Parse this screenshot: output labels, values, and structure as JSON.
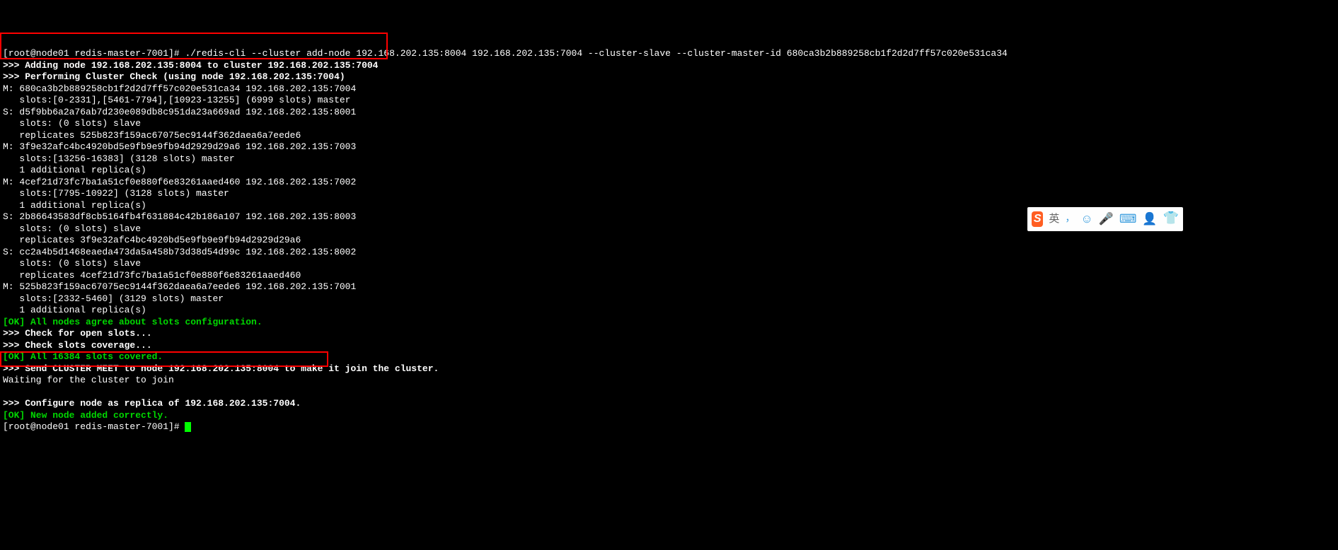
{
  "prompt1": "[root@node01 redis-master-7001]# ./redis-cli --cluster add-node 192.168.202.135:8004 192.168.202.135:7004 --cluster-slave --cluster-master-id 680ca3b2b889258cb1f2d2d7ff57c020e531ca34",
  "line_add": ">>> Adding node 192.168.202.135:8004 to cluster 192.168.202.135:7004",
  "line_check": ">>> Performing Cluster Check (using node 192.168.202.135:7004)",
  "m1_l1": "M: 680ca3b2b889258cb1f2d2d7ff57c020e531ca34 192.168.202.135:7004",
  "m1_l2": "   slots:[0-2331],[5461-7794],[10923-13255] (6999 slots) master",
  "s1_l1": "S: d5f9bb6a2a76ab7d230e089db8c951da23a669ad 192.168.202.135:8001",
  "s1_l2": "   slots: (0 slots) slave",
  "s1_l3": "   replicates 525b823f159ac67075ec9144f362daea6a7eede6",
  "m2_l1": "M: 3f9e32afc4bc4920bd5e9fb9e9fb94d2929d29a6 192.168.202.135:7003",
  "m2_l2": "   slots:[13256-16383] (3128 slots) master",
  "m2_l3": "   1 additional replica(s)",
  "m3_l1": "M: 4cef21d73fc7ba1a51cf0e880f6e83261aaed460 192.168.202.135:7002",
  "m3_l2": "   slots:[7795-10922] (3128 slots) master",
  "m3_l3": "   1 additional replica(s)",
  "s2_l1": "S: 2b86643583df8cb5164fb4f631884c42b186a107 192.168.202.135:8003",
  "s2_l2": "   slots: (0 slots) slave",
  "s2_l3": "   replicates 3f9e32afc4bc4920bd5e9fb9e9fb94d2929d29a6",
  "s3_l1": "S: cc2a4b5d1468eaeda473da5a458b73d38d54d99c 192.168.202.135:8002",
  "s3_l2": "   slots: (0 slots) slave",
  "s3_l3": "   replicates 4cef21d73fc7ba1a51cf0e880f6e83261aaed460",
  "m4_l1": "M: 525b823f159ac67075ec9144f362daea6a7eede6 192.168.202.135:7001",
  "m4_l2": "   slots:[2332-5460] (3129 slots) master",
  "m4_l3": "   1 additional replica(s)",
  "ok1": "[OK] All nodes agree about slots configuration.",
  "chk1": ">>> Check for open slots...",
  "chk2": ">>> Check slots coverage...",
  "ok2": "[OK] All 16384 slots covered.",
  "meet": ">>> Send CLUSTER MEET to node 192.168.202.135:8004 to make it join the cluster.",
  "wait": "Waiting for the cluster to join",
  "conf": ">>> Configure node as replica of 192.168.202.135:7004.",
  "ok3": "[OK] New node added correctly.",
  "prompt2": "[root@node01 redis-master-7001]# ",
  "ime": {
    "logo": "S",
    "lang": "英",
    "comma": "，",
    "face": "☺",
    "mic": "🎤",
    "kbd": "⌨",
    "person": "👤",
    "tshirt": "👕"
  }
}
